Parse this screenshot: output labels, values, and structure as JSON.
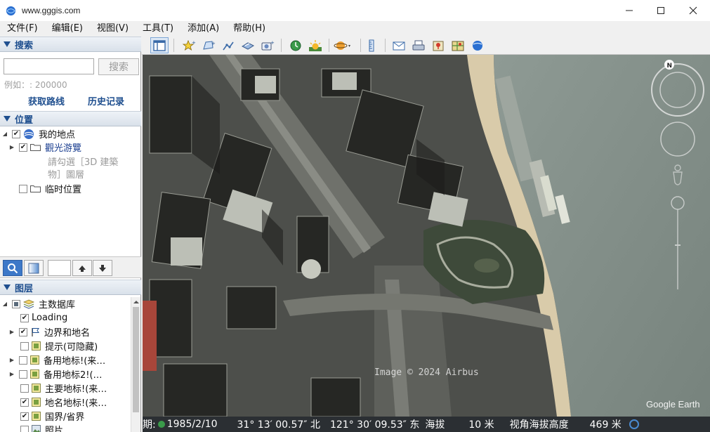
{
  "window": {
    "title": "www.gggis.com"
  },
  "menu": [
    {
      "label": "文件(F)",
      "key": "file"
    },
    {
      "label": "编辑(E)",
      "key": "edit"
    },
    {
      "label": "视图(V)",
      "key": "view"
    },
    {
      "label": "工具(T)",
      "key": "tools"
    },
    {
      "label": "添加(A)",
      "key": "add"
    },
    {
      "label": "帮助(H)",
      "key": "help"
    }
  ],
  "search": {
    "header": "搜索",
    "placeholder": "",
    "button": "搜索",
    "example": "例如：: 200000",
    "get_route": "获取路线",
    "history": "历史记录"
  },
  "places": {
    "header": "位置",
    "my_places": "我的地点",
    "sightseeing": "觀光游覽",
    "hint_line1": "請勾選［3D 建築",
    "hint_line2": "物］圖層",
    "temp": "临时位置"
  },
  "layers": {
    "header": "图层",
    "items": [
      {
        "label": "主数据库",
        "checked": "partial"
      },
      {
        "label": "Loading",
        "checked": true
      },
      {
        "label": "边界和地名",
        "checked": true
      },
      {
        "label": "提示(可隐藏)",
        "checked": false
      },
      {
        "label": "备用地标!(来…",
        "checked": false
      },
      {
        "label": "备用地标2!(…",
        "checked": false
      },
      {
        "label": "主要地标!(来…",
        "checked": false
      },
      {
        "label": "地名地标!(来…",
        "checked": true
      },
      {
        "label": "国界/省界",
        "checked": true
      },
      {
        "label": "照片",
        "checked": false
      }
    ]
  },
  "map": {
    "copyright": "Image © 2024 Airbus",
    "brand": "Google Earth",
    "compass_n": "N"
  },
  "status": {
    "date_prefix": "期:",
    "date": "1985/2/10",
    "lat": "31° 13′ 00.57″ 北",
    "lon": "121° 30′ 09.53″ 东",
    "elev_label": "海拔",
    "elev_value": "10 米",
    "eye_label": "视角海拔高度",
    "eye_value": "469 米"
  },
  "colors": {
    "accent": "#1f4f8f",
    "water": "#7f8c86",
    "land": "#4a4c48",
    "beach": "#d6c8a8"
  }
}
